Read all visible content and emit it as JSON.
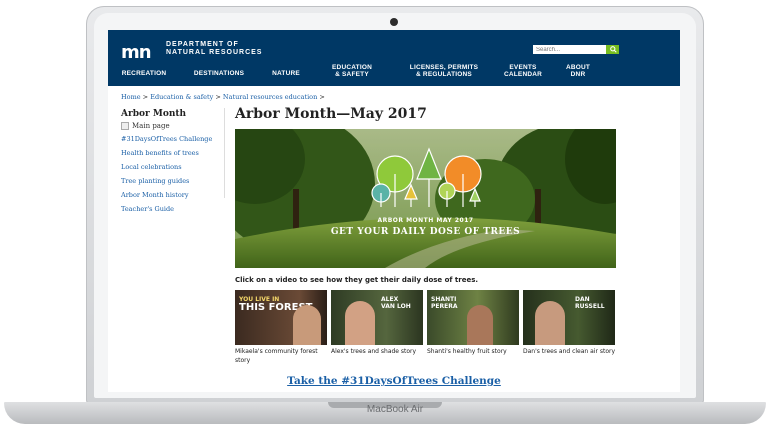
{
  "device": {
    "brand_label": "MacBook Air"
  },
  "header": {
    "logo_mark": "mn",
    "org_line1": "DEPARTMENT OF",
    "org_line2": "NATURAL RESOURCES",
    "search_placeholder": "Search...",
    "search_button": "Go",
    "nav": [
      {
        "line1": "RECREATION",
        "line2": ""
      },
      {
        "line1": "DESTINATIONS",
        "line2": ""
      },
      {
        "line1": "NATURE",
        "line2": ""
      },
      {
        "line1": "EDUCATION",
        "line2": "& SAFETY"
      },
      {
        "line1": "LICENSES, PERMITS",
        "line2": "& REGULATIONS"
      },
      {
        "line1": "EVENTS",
        "line2": "CALENDAR"
      },
      {
        "line1": "ABOUT",
        "line2": "DNR"
      }
    ]
  },
  "breadcrumb": {
    "items": [
      "Home",
      "Education & safety",
      "Natural resources education"
    ],
    "separator": ">"
  },
  "sidebar": {
    "title": "Arbor Month",
    "main_page": "Main page",
    "links": [
      "#31DaysOfTrees Challenge",
      "Health benefits of trees",
      "Local celebrations",
      "Tree planting guides",
      "Arbor Month history",
      "Teacher's Guide"
    ]
  },
  "main": {
    "title": "Arbor Month—May 2017",
    "hero": {
      "caption_small": "ARBOR MONTH MAY 2017",
      "caption_large": "GET YOUR DAILY DOSE OF TREES"
    },
    "video_intro": "Click on a video to see how they get their daily dose of trees.",
    "videos": [
      {
        "overlay_line1": "YOU LIVE IN",
        "overlay_big": "THIS FOREST",
        "caption": "Mikaela's community forest story"
      },
      {
        "overlay_line1": "ALEX",
        "overlay_big": "VAN LOH",
        "caption": "Alex's trees and shade story"
      },
      {
        "overlay_line1": "SHANTI",
        "overlay_big": "PERERA",
        "caption": "Shanti's healthy fruit story"
      },
      {
        "overlay_line1": "DAN",
        "overlay_big": "RUSSELL",
        "caption": "Dan's trees and clean air story"
      }
    ],
    "challenge_link": "Take the #31DaysOfTrees Challenge"
  },
  "colors": {
    "header_bg": "#003865",
    "accent_green": "#78be20",
    "link_blue": "#1a5fa6"
  }
}
